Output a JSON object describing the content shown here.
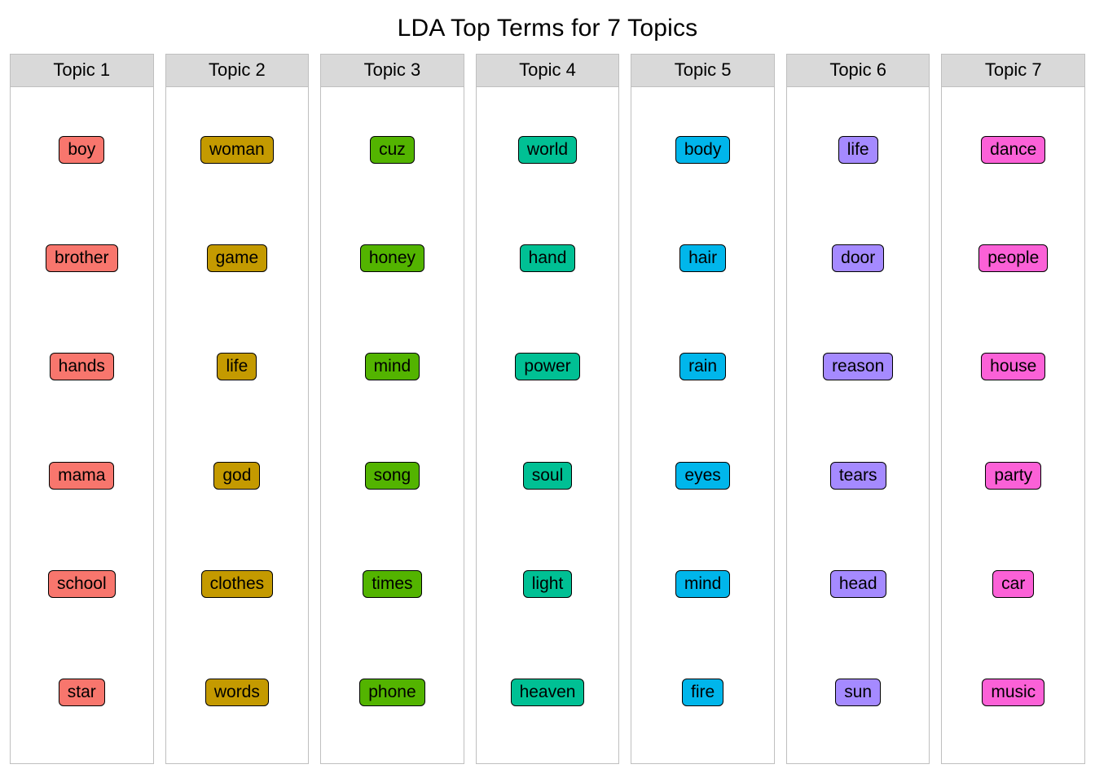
{
  "title": "LDA Top Terms for 7 Topics",
  "colors": {
    "topic1": "#F8766D",
    "topic2": "#C49A00",
    "topic3": "#53B400",
    "topic4": "#00C094",
    "topic5": "#00B6EB",
    "topic6": "#A58AFF",
    "topic7": "#FB61D7"
  },
  "chart_data": {
    "type": "table",
    "title": "LDA Top Terms for 7 Topics",
    "topics": [
      {
        "name": "Topic 1",
        "color": "#F8766D",
        "terms": [
          "boy",
          "brother",
          "hands",
          "mama",
          "school",
          "star"
        ]
      },
      {
        "name": "Topic 2",
        "color": "#C49A00",
        "terms": [
          "woman",
          "game",
          "life",
          "god",
          "clothes",
          "words"
        ]
      },
      {
        "name": "Topic 3",
        "color": "#53B400",
        "terms": [
          "cuz",
          "honey",
          "mind",
          "song",
          "times",
          "phone"
        ]
      },
      {
        "name": "Topic 4",
        "color": "#00C094",
        "terms": [
          "world",
          "hand",
          "power",
          "soul",
          "light",
          "heaven"
        ]
      },
      {
        "name": "Topic 5",
        "color": "#00B6EB",
        "terms": [
          "body",
          "hair",
          "rain",
          "eyes",
          "mind",
          "fire"
        ]
      },
      {
        "name": "Topic 6",
        "color": "#A58AFF",
        "terms": [
          "life",
          "door",
          "reason",
          "tears",
          "head",
          "sun"
        ]
      },
      {
        "name": "Topic 7",
        "color": "#FB61D7",
        "terms": [
          "dance",
          "people",
          "house",
          "party",
          "car",
          "music"
        ]
      }
    ]
  }
}
